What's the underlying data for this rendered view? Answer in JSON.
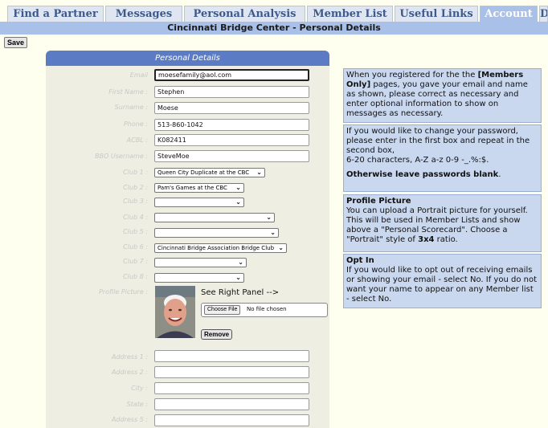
{
  "tabs": [
    {
      "label": "Find a Partner",
      "active": false
    },
    {
      "label": "Messages",
      "active": false
    },
    {
      "label": "Personal Analysis",
      "active": false
    },
    {
      "label": "Member List",
      "active": false
    },
    {
      "label": "Useful Links",
      "active": false
    },
    {
      "label": "Account",
      "active": true
    },
    {
      "label": "Download",
      "active": false
    }
  ],
  "title": "Cincinnati Bridge Center - Personal Details",
  "save_label": "Save",
  "form": {
    "header": "Personal Details",
    "email": {
      "label": "Email",
      "value": "moesefamily@aol.com"
    },
    "first_name": {
      "label": "First Name :",
      "value": "Stephen"
    },
    "surname": {
      "label": "Surname :",
      "value": "Moese"
    },
    "phone": {
      "label": "Phone :",
      "value": "513-860-1042"
    },
    "acbl": {
      "label": "ACBL :",
      "value": "K082411"
    },
    "bbo": {
      "label": "BBO Username :",
      "value": "SteveMoe"
    },
    "club1": {
      "label": "Club 1 :",
      "value": "Queen City Duplicate at the CBC"
    },
    "club2": {
      "label": "Club 2 :",
      "value": "Pam's Games at the CBC"
    },
    "club3": {
      "label": "Club 3 :",
      "value": ""
    },
    "club4": {
      "label": "Club 4 :",
      "value": ""
    },
    "club5": {
      "label": "Club 5 :",
      "value": ""
    },
    "club6": {
      "label": "Club 6 :",
      "value": "Cincinnati Bridge Association Bridge Club"
    },
    "club7": {
      "label": "Club 7 :",
      "value": ""
    },
    "club8": {
      "label": "Club 8 :",
      "value": ""
    },
    "profile_picture_label": "Profile Picture :",
    "see_right": "See Right Panel -->",
    "choose_file": "Choose File",
    "no_file": "No file chosen",
    "remove": "Remove",
    "address1": {
      "label": "Address 1 :",
      "value": ""
    },
    "address2": {
      "label": "Address 2 :",
      "value": ""
    },
    "city": {
      "label": "City :",
      "value": ""
    },
    "state": {
      "label": "State :",
      "value": ""
    },
    "address5": {
      "label": "Address 5 :",
      "value": ""
    }
  },
  "panel": {
    "box1_a": "When you registered for the the ",
    "box1_bold": "[Members Only]",
    "box1_b": " pages, you gave your email and name as shown, please correct as necessary and enter optional information to show on messages as necessary.",
    "box2_a": "If you would like to change your password, please enter in the first box and repeat in the second box,",
    "box2_b": "6-20 characters, A-Z a-z 0-9 -_.%:$.",
    "box2_bold": "Otherwise leave passwords blank",
    "box2_end": ".",
    "box3_title": "Profile Picture",
    "box3_a": "You can upload a Portrait picture for yourself. This will be used in Member Lists and show above a \"Personal Scorecard\". Choose a \"Portrait\" style of ",
    "box3_bold": "3x4",
    "box3_end": " ratio.",
    "box4_title": "Opt In",
    "box4_text": "If you would like to opt out of receiving emails or showing your email - select No. If you do not want your name to appear on any Member list - select No."
  }
}
